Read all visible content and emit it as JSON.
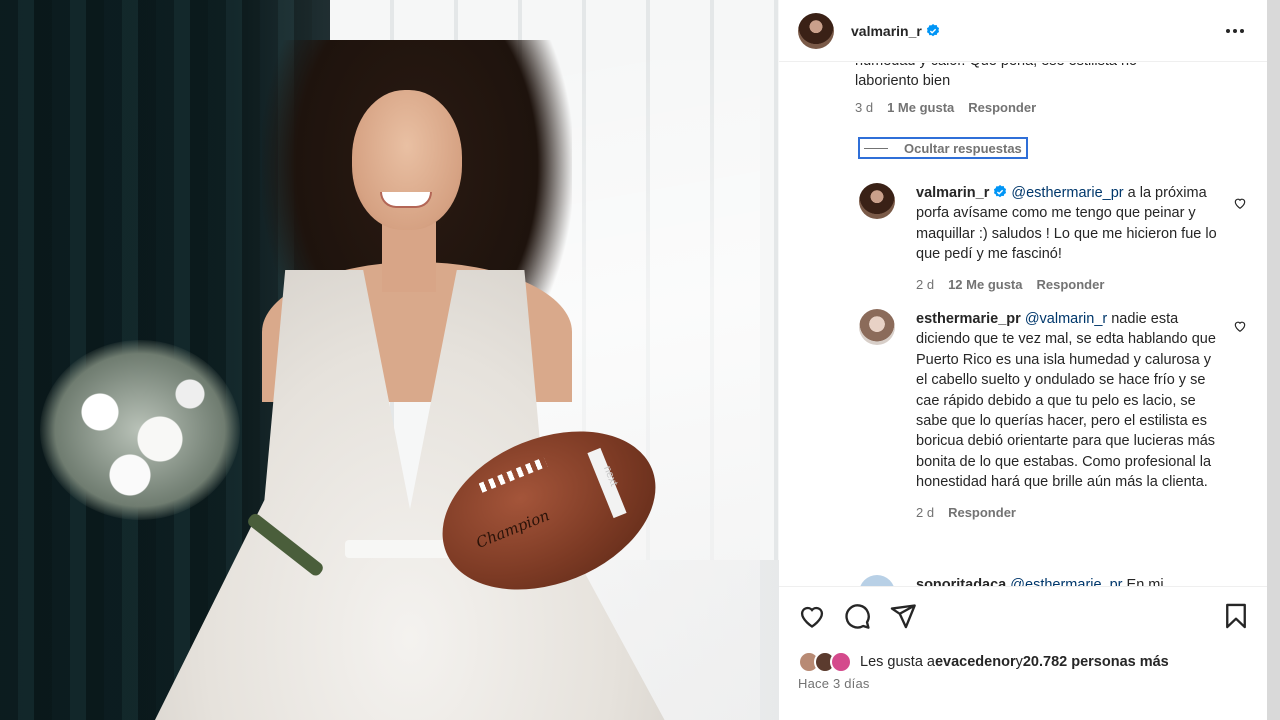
{
  "post": {
    "username": "valmarin_r"
  },
  "comments": {
    "clipped_text": "humedad y calor. Que pena, ese estilista no",
    "first_tail": "laboriento bien",
    "first_age": "3 d",
    "first_likes": "1 Me gusta",
    "reply_label": "Responder",
    "hide_replies": "Ocultar respuestas",
    "replies": [
      {
        "username": "valmarin_r",
        "mention": "@esthermarie_pr",
        "text": " a la próxima porfa avísame como me tengo que peinar y maquillar :) saludos ! Lo que me hicieron fue lo que pedí y me fascinó!",
        "age": "2 d",
        "likes": "12 Me gusta",
        "reply": "Responder"
      },
      {
        "username": "esthermarie_pr",
        "mention": "@valmarin_r",
        "text": " nadie esta diciendo que te vez mal, se edta hablando que Puerto Rico es una isla humedad y calurosa y el cabello suelto y ondulado se hace frío y se cae rápido debido a que tu pelo es lacio, se sabe que lo querías hacer, pero el estilista es boricua debió orientarte para que lucieras más bonita de lo que estabas. Como profesional la honestidad hará que brille aún más la clienta.",
        "age": "2 d",
        "reply": "Responder"
      },
      {
        "username": "sonoritadaca",
        "mention": "@esthermarie_pr",
        "text": " En mi"
      }
    ]
  },
  "footer": {
    "likes_prefix": "Les gusta a ",
    "likes_user": "evacedenor",
    "likes_mid": " y ",
    "likes_count": "20.782 personas más",
    "date": "Hace 3 días"
  },
  "photo": {
    "ball_brand": "Champion",
    "ball_brand2": "next"
  },
  "colors": {
    "verified": "#0095f6",
    "mention": "#00376b",
    "focus_ring": "#2f6fd8"
  }
}
